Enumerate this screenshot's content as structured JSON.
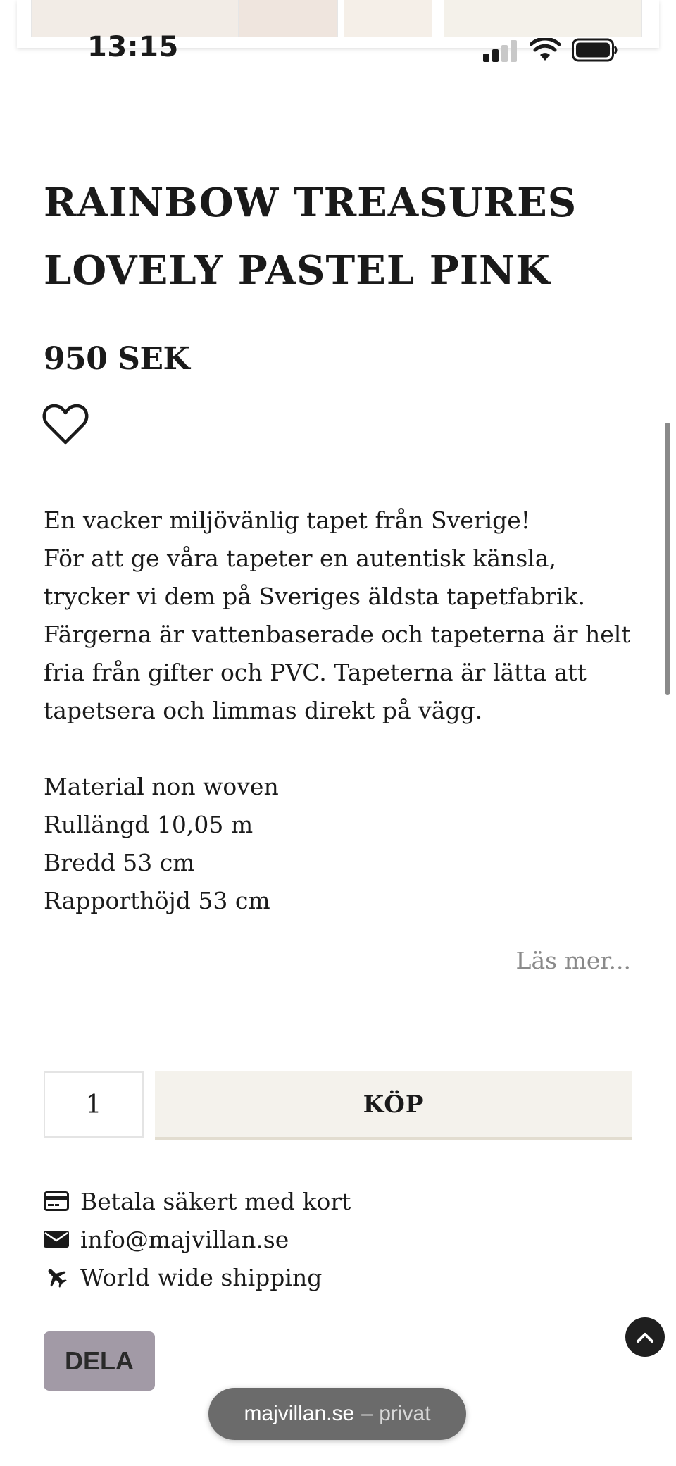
{
  "status_bar": {
    "time": "13:15"
  },
  "product": {
    "title_line1": "RAINBOW TREASURES",
    "title_line2": "LOVELY PASTEL PINK",
    "price": "950 SEK",
    "description": [
      "En vacker miljövänlig tapet från Sverige!",
      "För att ge våra tapeter en autentisk känsla, trycker vi dem på Sveriges äldsta tapetfabrik. Färgerna är vattenbaserade och tapeterna är helt fria från gifter och PVC. Tapeterna är lätta att tapetsera och limmas direkt på vägg."
    ],
    "specs": [
      "Material non woven",
      "Rullängd 10,05 m",
      "Bredd 53 cm",
      "Rapporthöjd 53 cm"
    ],
    "read_more": "Läs mer..."
  },
  "purchase": {
    "quantity": "1",
    "buy_label": "KÖP"
  },
  "features": [
    {
      "icon": "credit-card-icon",
      "label": "Betala säkert med kort"
    },
    {
      "icon": "envelope-icon",
      "label": "info@majvillan.se"
    },
    {
      "icon": "airplane-icon",
      "label": "World wide shipping"
    }
  ],
  "share": {
    "label": "DELA"
  },
  "browser": {
    "domain": "majvillan.se",
    "mode": "– privat"
  },
  "colors": {
    "buy_bg": "#f4f2ec",
    "share_bg": "#a29aa6",
    "url_pill_bg": "#6b6b6b"
  }
}
